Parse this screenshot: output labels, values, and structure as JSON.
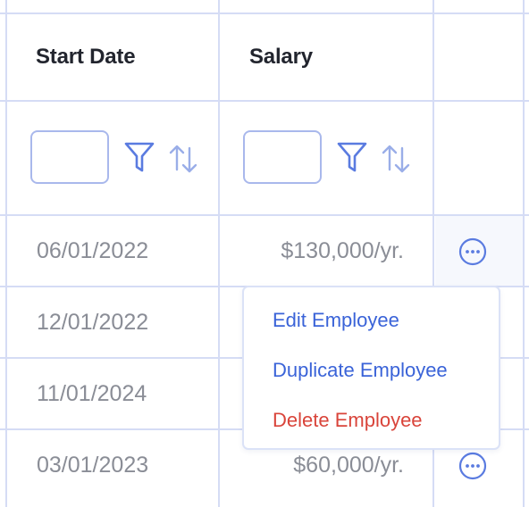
{
  "table": {
    "columns": [
      {
        "label": "Start Date"
      },
      {
        "label": "Salary"
      },
      {
        "label": ""
      }
    ],
    "rows": [
      {
        "start_date": "06/01/2022",
        "salary": "$130,000/yr."
      },
      {
        "start_date": "12/01/2022",
        "salary": ""
      },
      {
        "start_date": "11/01/2024",
        "salary": ""
      },
      {
        "start_date": "03/01/2023",
        "salary": "$60,000/yr."
      }
    ],
    "filters": {
      "start_date": {
        "value": "",
        "placeholder": ""
      },
      "salary": {
        "value": "",
        "placeholder": ""
      }
    }
  },
  "context_menu": {
    "items": [
      {
        "label": "Edit Employee",
        "color": "#3a63d8"
      },
      {
        "label": "Duplicate Employee",
        "color": "#3a63d8"
      },
      {
        "label": "Delete Employee",
        "color": "#d9443a"
      }
    ]
  },
  "icons": {
    "filter": "filter-icon",
    "sort": "sort-icon",
    "row_actions": "more-horizontal-icon"
  },
  "colors": {
    "grid_line": "#d5dcf5",
    "accent": "#3a63d8",
    "danger": "#d9443a",
    "active_row_bg": "#f6f8fd",
    "icon_blue": "#5a7be0"
  }
}
